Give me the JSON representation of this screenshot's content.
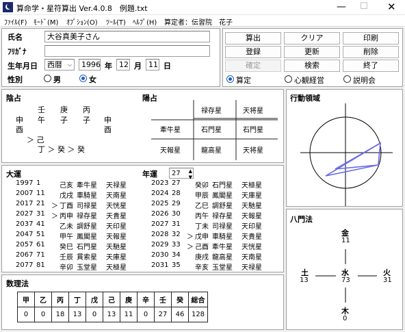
{
  "window": {
    "title": "算命学・星符算出 Ver.4.0.8　例題.txt"
  },
  "menu": [
    "ﾌｧｲﾙ(F)",
    "ﾓｰﾄﾞ(M)",
    "ｵﾌﾟｼｮﾝ(O)",
    "ﾂｰﾙ(T)",
    "ﾍﾙﾌﾟ(H)",
    "算定者：伝習院　花子"
  ],
  "form": {
    "name_label": "氏名",
    "name_value": "大谷真美子さん",
    "kana_label": "ﾌﾘｶﾞﾅ",
    "kana_value": "",
    "birth_label": "生年月日",
    "era": "西暦",
    "year": "1996",
    "year_unit": "年",
    "month": "12",
    "month_unit": "月",
    "day": "11",
    "day_unit": "日",
    "sex_label": "性別",
    "male": "男",
    "female": "女",
    "selected_sex": "女"
  },
  "buttons": [
    {
      "label": "算出",
      "enabled": true
    },
    {
      "label": "クリア",
      "enabled": true
    },
    {
      "label": "印刷",
      "enabled": true
    },
    {
      "label": "登録",
      "enabled": true
    },
    {
      "label": "更新",
      "enabled": true
    },
    {
      "label": "削除",
      "enabled": true
    },
    {
      "label": "確定",
      "enabled": false
    },
    {
      "label": "検索",
      "enabled": true
    },
    {
      "label": "終了",
      "enabled": true
    }
  ],
  "modes": {
    "options": [
      "算定",
      "心観経営",
      "説明会"
    ],
    "selected": "算定"
  },
  "inyo": {
    "title": "陰占",
    "row1": [
      "",
      "壬",
      "庚",
      "丙",
      ""
    ],
    "row2": [
      "申",
      "午",
      "子",
      "子",
      "申"
    ],
    "row3": [
      "酉",
      "",
      "",
      "",
      "酉"
    ],
    "row4": "＞ 己",
    "row5": "丁 ＞ 癸 ＞ 癸"
  },
  "yosen": {
    "title": "陽占",
    "cells": [
      [
        "",
        "禄存星",
        "天将星"
      ],
      [
        "牽牛星",
        "石門星",
        "石門星"
      ],
      [
        "天報星",
        "龍高星",
        "天将星"
      ]
    ]
  },
  "taiun": {
    "title": "大運",
    "left": [
      [
        "1997",
        "1",
        "",
        "己亥",
        "牽牛星",
        "天禄星"
      ],
      [
        "2007",
        "11",
        "",
        "戊戌",
        "車騎星",
        "天南星"
      ],
      [
        "2017",
        "21",
        "＞",
        "丁酉",
        "司禄星",
        "天恍星"
      ],
      [
        "2027",
        "31",
        "＞",
        "丙申",
        "禄存星",
        "天貴星"
      ],
      [
        "2037",
        "41",
        "",
        "乙未",
        "調舒星",
        "天印星"
      ],
      [
        "2047",
        "51",
        "",
        "甲午",
        "鳳閣星",
        "天報星"
      ],
      [
        "2057",
        "61",
        "",
        "癸巳",
        "石門星",
        "天馳星"
      ],
      [
        "2067",
        "71",
        "",
        "壬辰",
        "貫索星",
        "天庫星"
      ],
      [
        "2077",
        "81",
        "",
        "辛卯",
        "玉堂星",
        "天極星"
      ]
    ],
    "nen_label": "年運",
    "nen_age": "27",
    "right": [
      [
        "2023",
        "27",
        "",
        "癸卯",
        "石門星",
        "天極星"
      ],
      [
        "2024",
        "28",
        "",
        "甲辰",
        "鳳閣星",
        "天庫星"
      ],
      [
        "2025",
        "29",
        "",
        "乙巳",
        "調舒星",
        "天馳星"
      ],
      [
        "2026",
        "30",
        "",
        "丙午",
        "禄存星",
        "天報星"
      ],
      [
        "2027",
        "31",
        "",
        "丁未",
        "司禄星",
        "天印星"
      ],
      [
        "2028",
        "32",
        "＞",
        "戊申",
        "車騎星",
        "天貴星"
      ],
      [
        "2029",
        "33",
        "＞",
        "己酉",
        "牽牛星",
        "天恍星"
      ],
      [
        "2030",
        "34",
        "",
        "庚戌",
        "龍高星",
        "天南星"
      ],
      [
        "2031",
        "35",
        "",
        "辛亥",
        "玉堂星",
        "天禄星"
      ]
    ]
  },
  "suri": {
    "title": "数理法",
    "headers": [
      "甲",
      "乙",
      "丙",
      "丁",
      "戊",
      "己",
      "庚",
      "辛",
      "壬",
      "癸",
      "総合"
    ],
    "values": [
      "0",
      "0",
      "18",
      "13",
      "0",
      "13",
      "11",
      "0",
      "27",
      "46",
      "128"
    ]
  },
  "kodo": {
    "title": "行動領域"
  },
  "hachimon": {
    "title": "八門法",
    "north": {
      "name": "金",
      "value": "11"
    },
    "west": {
      "name": "土",
      "value": "13"
    },
    "center": {
      "name": "水",
      "value": "73"
    },
    "east": {
      "name": "火",
      "value": "31"
    },
    "south": {
      "name": "木",
      "value": "0"
    }
  }
}
